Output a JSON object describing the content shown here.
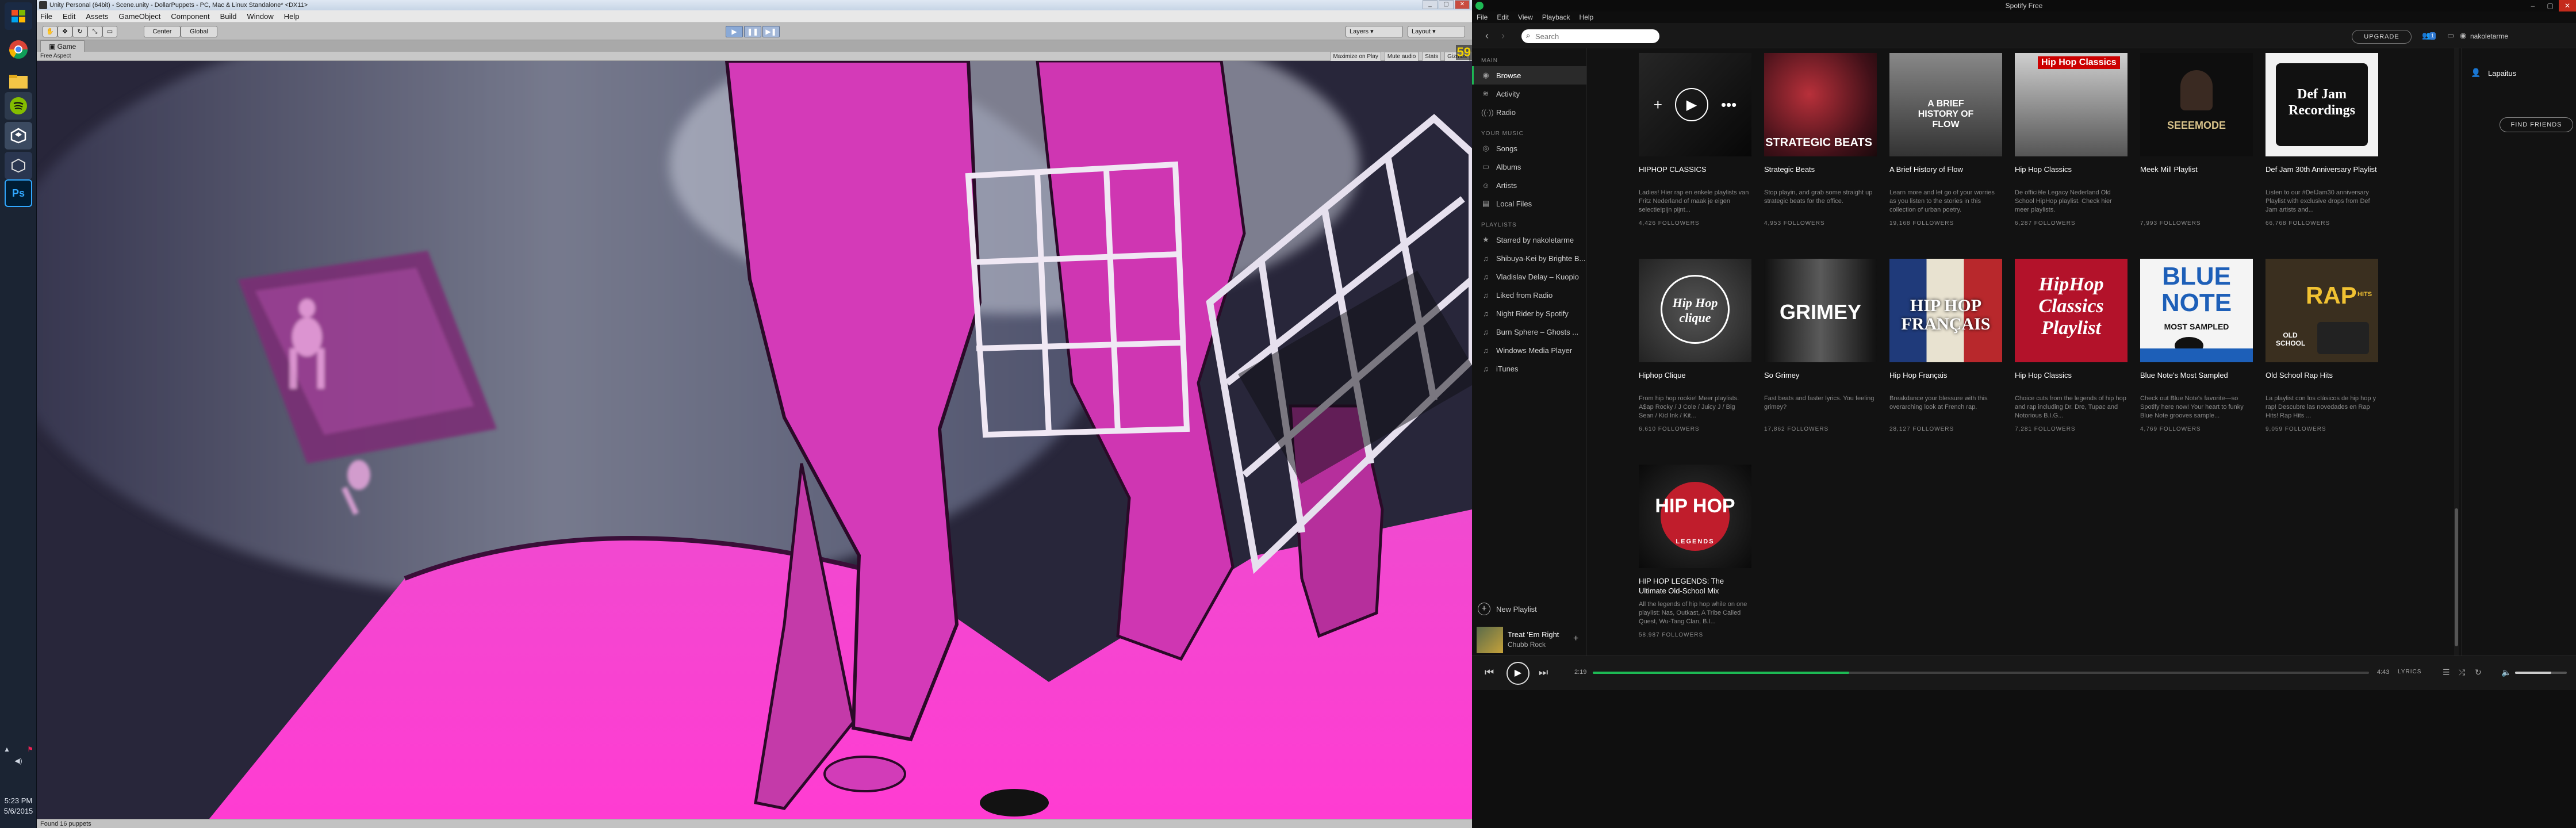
{
  "taskbar": {
    "clock_time": "5:23 PM",
    "clock_date": "5/6/2015",
    "icons": [
      "windows-logo-icon",
      "chrome-icon",
      "file-explorer-icon",
      "spotify-icon",
      "unity-icon",
      "unity-icon-2",
      "photoshop-icon"
    ]
  },
  "unity": {
    "title": "Unity Personal (64bit) - Scene.unity - DollarPuppets - PC, Mac & Linux Standalone* <DX11>",
    "menu": [
      "File",
      "Edit",
      "Assets",
      "GameObject",
      "Component",
      "Build",
      "Window",
      "Help"
    ],
    "toolbar": {
      "center": "Center",
      "global": "Global",
      "layers": "Layers",
      "layout": "Layout"
    },
    "tab_game": "Game",
    "aspect": "Free Aspect",
    "options": [
      "Maximize on Play",
      "Mute audio",
      "Stats",
      "Gizmos"
    ],
    "fps": "59",
    "status": "Found 16 puppets"
  },
  "spotify": {
    "title": "Spotify Free",
    "menu": [
      "File",
      "Edit",
      "View",
      "Playback",
      "Help"
    ],
    "search_placeholder": "Search",
    "upgrade": "UPGRADE",
    "notif_count": "1",
    "username": "nakoletarme",
    "sidebar": {
      "main_header": "MAIN",
      "main": [
        {
          "label": "Browse",
          "icon": "browse-icon"
        },
        {
          "label": "Activity",
          "icon": "activity-icon"
        },
        {
          "label": "Radio",
          "icon": "radio-icon"
        }
      ],
      "music_header": "YOUR MUSIC",
      "music": [
        {
          "label": "Songs",
          "icon": "songs-icon"
        },
        {
          "label": "Albums",
          "icon": "albums-icon"
        },
        {
          "label": "Artists",
          "icon": "artists-icon"
        },
        {
          "label": "Local Files",
          "icon": "local-files-icon"
        }
      ],
      "playlists_header": "PLAYLISTS",
      "playlists": [
        "Starred by nakoletarme",
        "Shibuya-Kei by Brighte B...",
        "Vladislav Delay – Kuopio",
        "Liked from Radio",
        "Night Rider by Spotify",
        "Burn Sphere – Ghosts ...",
        "Windows Media Player",
        "iTunes"
      ],
      "new_playlist": "New Playlist"
    },
    "now_playing": {
      "title": "Treat 'Em Right",
      "artist": "Chubb Rock"
    },
    "cards": [
      {
        "title": "HIPHOP CLASSICS",
        "desc": "Ladies! Hier rap en enkele playlists van Fritz Nederland of maak je eigen selectie!pijn pijnt...",
        "followers": "4,426 FOLLOWERS"
      },
      {
        "title": "Strategic Beats",
        "desc": "Stop playin, and grab some straight up strategic beats for the office.",
        "followers": "4,953 FOLLOWERS"
      },
      {
        "title": "A Brief History of Flow",
        "desc": "Learn more and let go of your worries as you listen to the stories in this collection of urban poetry.",
        "followers": "19,168 FOLLOWERS"
      },
      {
        "title": "Hip Hop Classics",
        "desc": "De officiële Legacy Nederland Old School HipHop playlist. Check hier meer playlists.",
        "followers": "6,287 FOLLOWERS"
      },
      {
        "title": "Meek Mill Playlist",
        "desc": "",
        "followers": "7,993 FOLLOWERS"
      },
      {
        "title": "Def Jam 30th Anniversary Playlist",
        "desc": "Listen to our #DefJam30 anniversary Playlist with exclusive drops from Def Jam artists and...",
        "followers": "66,768 FOLLOWERS"
      },
      {
        "title": "Hiphop Clique",
        "desc": "From hip hop rookie! Meer playlists. A$ap Rocky / J Cole / Juicy J / Big Sean / Kid Ink / Kit...",
        "followers": "6,610 FOLLOWERS"
      },
      {
        "title": "So Grimey",
        "desc": "Fast beats and faster lyrics. You feeling grimey?",
        "followers": "17,862 FOLLOWERS"
      },
      {
        "title": "Hip Hop Français",
        "desc": "Breakdance your blessure with this overarching look at French rap.",
        "followers": "28,127 FOLLOWERS"
      },
      {
        "title": "Hip Hop Classics",
        "desc": "Choice cuts from the legends of hip hop and rap including Dr. Dre, Tupac and Notorious B.I.G...",
        "followers": "7,281 FOLLOWERS"
      },
      {
        "title": "Blue Note's Most Sampled",
        "desc": "Check out Blue Note's favorite—so Spotify here now! Your heart to funky Blue Note grooves sample...",
        "followers": "4,769 FOLLOWERS"
      },
      {
        "title": "Old School Rap Hits",
        "desc": "La playlist con los clásicos de hip hop y rap! Descubre las novedades en Rap Hits! Rap Hits ...",
        "followers": "9,059 FOLLOWERS"
      },
      {
        "title": "HIP HOP LEGENDS: The Ultimate Old-School Mix",
        "desc": "All the legends of hip hop while on one playlist: Nas, Outkast, A Tribe Called Quest, Wu-Tang Clan, B.I...",
        "followers": "58,987 FOLLOWERS"
      }
    ],
    "art_text": {
      "strategic": "STRATEGIC BEATS",
      "brief": "A BRIEF HISTORY OF FLOW",
      "hhc_badge": "Hip Hop Classics",
      "meek": "SEEEMODE",
      "defjam": "Def Jam Recordings",
      "clique": "Hip Hop clique",
      "grimey": "GRIMEY",
      "francais": "HIP HOP FRANÇAIS",
      "classics": "HipHop Classics Playlist",
      "bluenote": "BLUE NOTE",
      "bluenote_sub": "MOST SAMPLED",
      "rap": "RAP",
      "rap_hits": "HITS",
      "old_school": "OLD SCHOOL",
      "legends": "HIP HOP",
      "legends_sub": "LEGENDS"
    },
    "friends": {
      "name": "Lapaitus",
      "find": "FIND FRIENDS"
    },
    "player": {
      "elapsed": "2:19",
      "total": "4:43",
      "progress": 0.33,
      "lyrics": "LYRICS",
      "volume": 0.7
    },
    "colors": {
      "accent": "#1db954",
      "bg": "#121212"
    }
  }
}
